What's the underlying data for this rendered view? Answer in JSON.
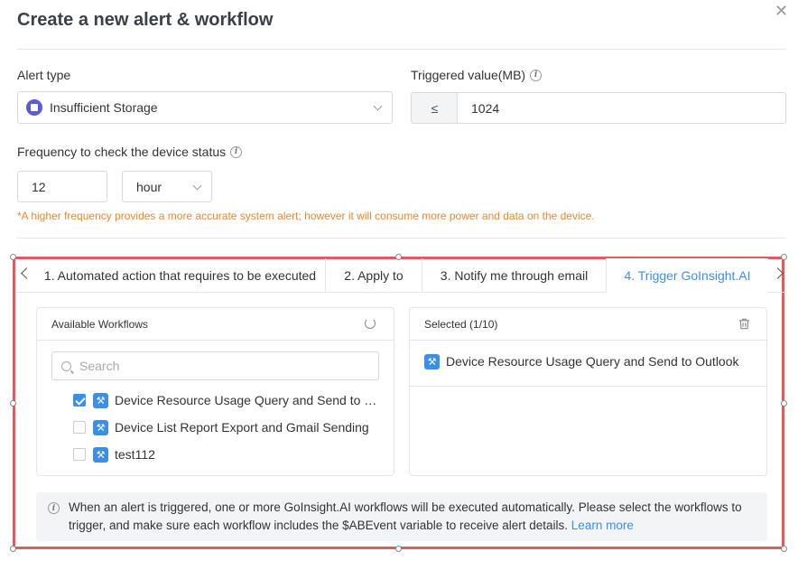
{
  "dialog": {
    "title": "Create a new alert & workflow",
    "close_icon": "close-icon"
  },
  "alert_type": {
    "label": "Alert type",
    "value": "Insufficient Storage",
    "icon": "storage-icon"
  },
  "triggered_value": {
    "label": "Triggered value(MB)",
    "operator": "≤",
    "value": "1024"
  },
  "frequency": {
    "label": "Frequency to check the device status",
    "value": "12",
    "unit": "hour",
    "warning": "*A higher frequency provides a more accurate system alert; however it will consume more power and data on the device."
  },
  "tabs": [
    {
      "label": "1. Automated action that requires to be executed",
      "active": false
    },
    {
      "label": "2. Apply to",
      "active": false
    },
    {
      "label": "3. Notify me through email",
      "active": false
    },
    {
      "label": "4. Trigger GoInsight.AI",
      "active": true
    }
  ],
  "available": {
    "title": "Available Workflows",
    "search_placeholder": "Search",
    "items": [
      {
        "label": "Device Resource Usage Query and Send to Out…",
        "checked": true
      },
      {
        "label": "Device List Report Export and Gmail Sending",
        "checked": false
      },
      {
        "label": "test112",
        "checked": false
      }
    ]
  },
  "selected": {
    "title": "Selected (1/10)",
    "items": [
      {
        "label": "Device Resource Usage Query and Send to Outlook"
      }
    ]
  },
  "notice": {
    "text": "When an alert is triggered, one or more GoInsight.AI workflows will be executed automatically. Please select the workflows to trigger, and make sure each workflow includes the $ABEvent variable to receive alert details.",
    "link": "Learn more"
  },
  "colors": {
    "accent": "#3b8fe8",
    "warning": "#e8892b",
    "highlight": "#e05b5b"
  }
}
